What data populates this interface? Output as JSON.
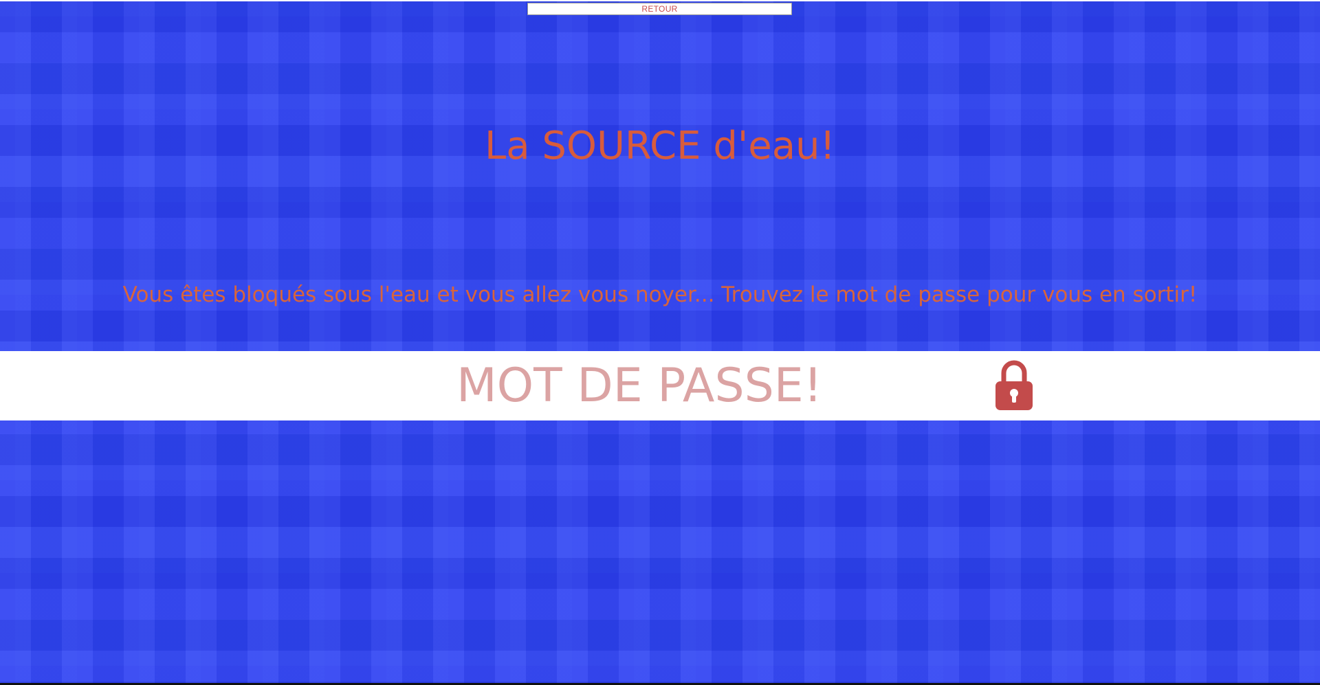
{
  "header": {
    "back_label": "RETOUR"
  },
  "main": {
    "title": "La SOURCE d'eau!",
    "instruction": "Vous êtes bloqués sous l'eau et vous allez vous noyer... Trouvez le mot de passe pour vous en sortir!"
  },
  "password": {
    "placeholder": "MOT DE PASSE!",
    "value": "",
    "lock_icon": "lock-icon"
  },
  "colors": {
    "background_blue": "#2b3ef1",
    "accent_orange": "#d85c3c",
    "placeholder_pink": "#dba3a3",
    "lock_red": "#c34b4b"
  }
}
